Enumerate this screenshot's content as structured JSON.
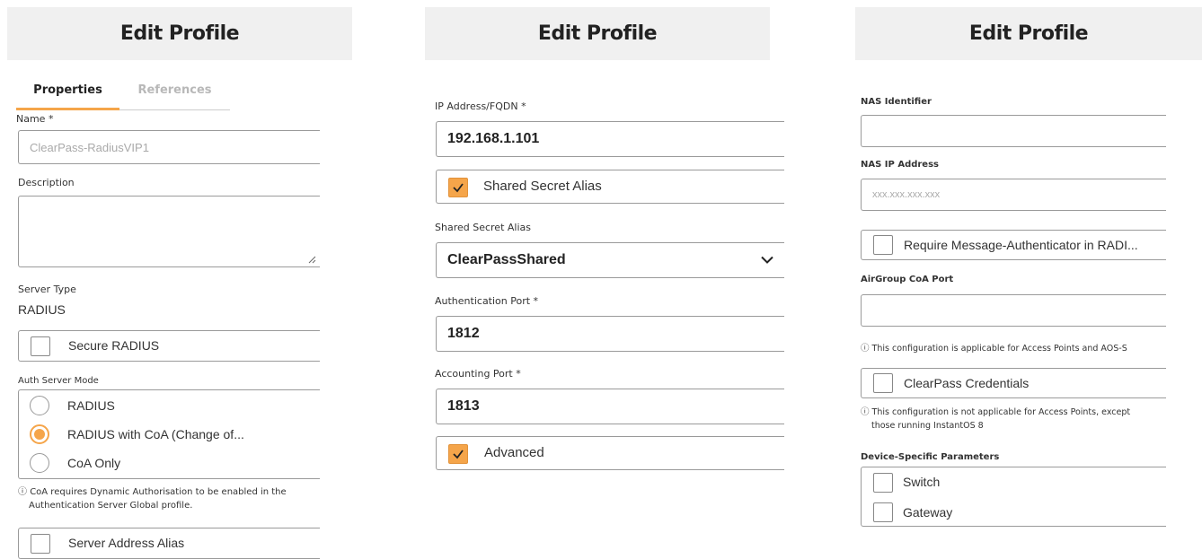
{
  "panel1": {
    "title": "Edit Profile",
    "tabs": [
      "Properties",
      "References"
    ],
    "name_label": "Name *",
    "name_placeholder": "ClearPass-RadiusVIP1",
    "description_label": "Description",
    "server_type_label": "Server Type",
    "server_type_value": "RADIUS",
    "secure_radius_label": "Secure RADIUS",
    "auth_mode_label": "Auth Server Mode",
    "auth_modes": [
      {
        "label": "RADIUS",
        "selected": false
      },
      {
        "label": "RADIUS with CoA (Change of...",
        "selected": true
      },
      {
        "label": "CoA Only",
        "selected": false
      }
    ],
    "coa_note_line1": "CoA requires Dynamic Authorisation to be enabled in the",
    "coa_note_line2": "Authentication Server Global profile.",
    "server_alias_label": "Server Address Alias"
  },
  "panel2": {
    "title": "Edit Profile",
    "ip_label": "IP Address/FQDN *",
    "ip_value": "192.168.1.101",
    "shared_secret_alias_checkbox": "Shared Secret Alias",
    "shared_secret_alias_label": "Shared Secret Alias",
    "shared_secret_alias_value": "ClearPassShared",
    "auth_port_label": "Authentication Port *",
    "auth_port_value": "1812",
    "acct_port_label": "Accounting Port *",
    "acct_port_value": "1813",
    "advanced_label": "Advanced"
  },
  "panel3": {
    "title": "Edit Profile",
    "nas_id_label": "NAS Identifier",
    "nas_ip_label": "NAS IP Address",
    "nas_ip_placeholder": "xxx.xxx.xxx.xxx",
    "require_msg_auth_label": "Require Message-Authenticator in RADI...",
    "airgroup_label": "AirGroup CoA Port",
    "airgroup_note": "This configuration is applicable for Access Points and AOS-S",
    "clearpass_cred_label": "ClearPass Credentials",
    "cred_note_line1": "This configuration is not applicable for Access Points, except",
    "cred_note_line2": "those running InstantOS 8",
    "device_params_label": "Device-Specific Parameters",
    "switch_label": "Switch",
    "gateway_label": "Gateway"
  },
  "colors": {
    "accent": "#f5a54a",
    "header_bg": "#f0f0f0",
    "border": "#9a9a9a"
  }
}
